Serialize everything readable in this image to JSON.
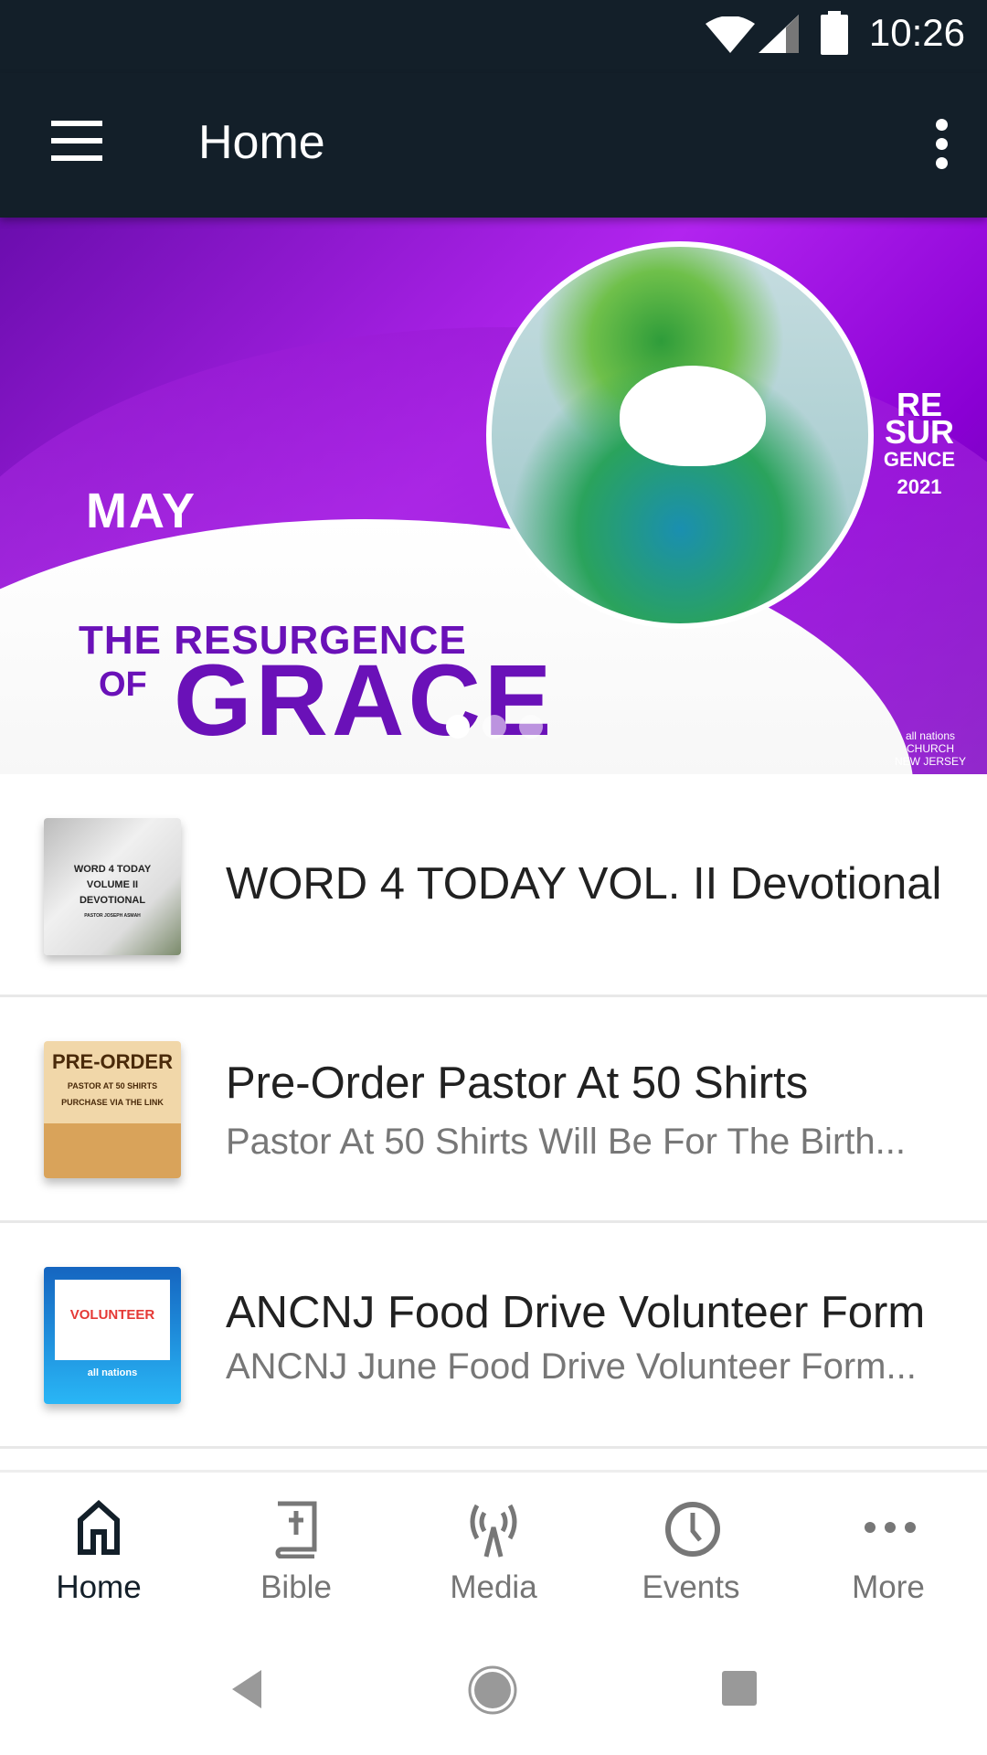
{
  "status_bar": {
    "time": "10:26",
    "icons": [
      "wifi-icon",
      "signal-icon",
      "battery-icon"
    ]
  },
  "app_bar": {
    "title": "Home",
    "menu_icon": "hamburger-icon",
    "overflow_icon": "more-vert-icon"
  },
  "banner": {
    "month": "MAY",
    "title_line1": "THE RESURGENCE",
    "title_of": "OF",
    "title_big": "GRACE",
    "logo_lines": [
      "RE",
      "SUR",
      "GENCE",
      "2021"
    ],
    "church": "all nations CHURCH NEW JERSEY",
    "active_slide": 1,
    "slide_count": 3
  },
  "list": [
    {
      "title": "WORD 4 TODAY VOL. II Devotional",
      "subtitle": "",
      "thumb_text": [
        "WORD 4 TODAY",
        "VOLUME II",
        "DEVOTIONAL",
        "PASTOR JOSEPH ASMAH"
      ]
    },
    {
      "title": "Pre-Order Pastor At 50 Shirts",
      "subtitle": "Pastor At 50 Shirts Will Be For The Birth...",
      "thumb_text": [
        "PRE-ORDER",
        "PASTOR AT 50 SHIRTS",
        "PURCHASE VIA THE LINK"
      ]
    },
    {
      "title": "ANCNJ Food Drive Volunteer Form",
      "subtitle": "ANCNJ June Food Drive Volunteer Form...",
      "thumb_text": [
        "VOLUNTEER",
        "all nations"
      ]
    }
  ],
  "bottom_nav": [
    {
      "label": "Home",
      "icon": "home-icon",
      "active": true
    },
    {
      "label": "Bible",
      "icon": "bible-icon",
      "active": false
    },
    {
      "label": "Media",
      "icon": "broadcast-icon",
      "active": false
    },
    {
      "label": "Events",
      "icon": "clock-icon",
      "active": false
    },
    {
      "label": "More",
      "icon": "more-horiz-icon",
      "active": false
    }
  ],
  "colors": {
    "app_bar": "#131f29",
    "active_tab": "#131f29",
    "inactive_tab": "#757575",
    "banner_purple": "#8a00d4"
  }
}
